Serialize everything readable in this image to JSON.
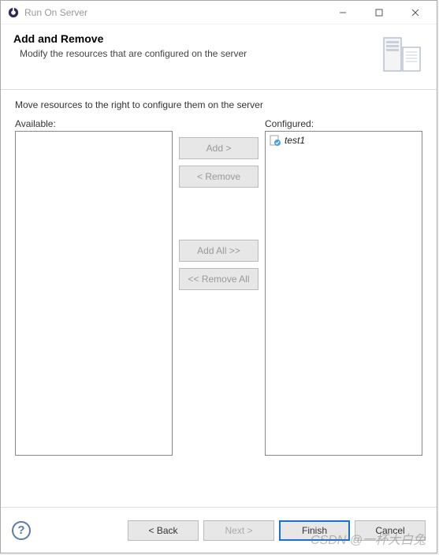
{
  "titlebar": {
    "title": "Run On Server"
  },
  "banner": {
    "title": "Add and Remove",
    "subtitle": "Modify the resources that are configured on the server"
  },
  "content": {
    "instruction": "Move resources to the right to configure them on the server",
    "available_label": "Available:",
    "configured_label": "Configured:",
    "buttons": {
      "add": "Add >",
      "remove": "< Remove",
      "add_all": "Add All >>",
      "remove_all": "<< Remove All"
    },
    "configured_items": [
      {
        "label": "test1"
      }
    ]
  },
  "footer": {
    "back": "< Back",
    "next": "Next >",
    "finish": "Finish",
    "cancel": "Cancel"
  },
  "watermark": "CSDN @一杯大白兔"
}
